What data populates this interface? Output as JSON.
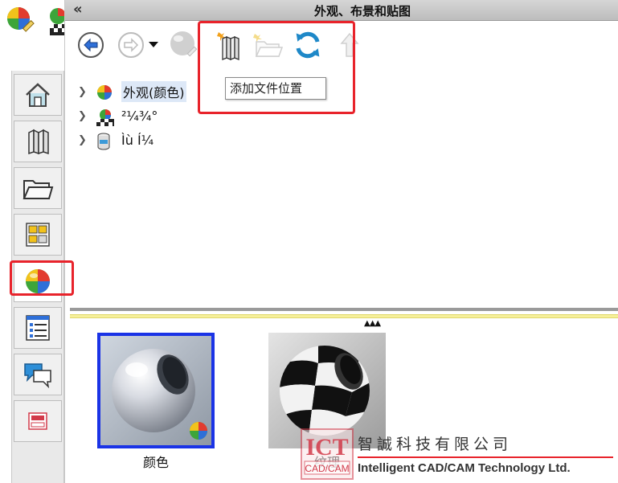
{
  "pane": {
    "title": "外观、布景和贴图",
    "collapse_label": "«"
  },
  "toolbar": {
    "buttons": [
      {
        "icon": "back-arrow-icon",
        "enabled": true
      },
      {
        "icon": "forward-arrow-icon",
        "enabled": false
      },
      {
        "icon": "dropdown-triangle-icon",
        "enabled": true
      },
      {
        "icon": "gray-sphere-icon",
        "enabled": false
      },
      {
        "icon": "add-file-location-icon",
        "enabled": true
      },
      {
        "icon": "new-folder-icon",
        "enabled": false
      },
      {
        "icon": "refresh-icon",
        "enabled": true
      },
      {
        "icon": "up-arrow-icon",
        "enabled": false
      }
    ],
    "tooltip": "添加文件位置"
  },
  "tree": {
    "items": [
      {
        "label": "外观(颜色)",
        "icon": "appearance-ball-icon",
        "selected": true
      },
      {
        "label": "²¼¾°",
        "icon": "scene-icon",
        "selected": false
      },
      {
        "label": "Ìù Í¼",
        "icon": "decal-cylinder-icon",
        "selected": false
      }
    ]
  },
  "thumbnails": [
    {
      "label": "颜色",
      "selected": true
    },
    {
      "label": "纹理",
      "selected": false
    }
  ],
  "sidebar": {
    "tabs": [
      {
        "icon": "home-icon"
      },
      {
        "icon": "library-books-icon"
      },
      {
        "icon": "folder-icon"
      },
      {
        "icon": "view-palette-icon"
      },
      {
        "icon": "appearance-ball-icon",
        "active": true
      },
      {
        "icon": "property-list-icon"
      },
      {
        "icon": "forum-chat-icon"
      },
      {
        "icon": "ict-logo-icon"
      }
    ]
  },
  "watermark": {
    "company_cn": "智誠科技有限公司",
    "company_en": "Intelligent CAD/CAM Technology Ltd.",
    "logo_text_top": "ICT",
    "logo_text_bottom": "CAD/CAM"
  },
  "colors": {
    "highlight": "#e8232b",
    "selection_border": "#1a33e6",
    "tree_selection": "#dde8f7"
  }
}
